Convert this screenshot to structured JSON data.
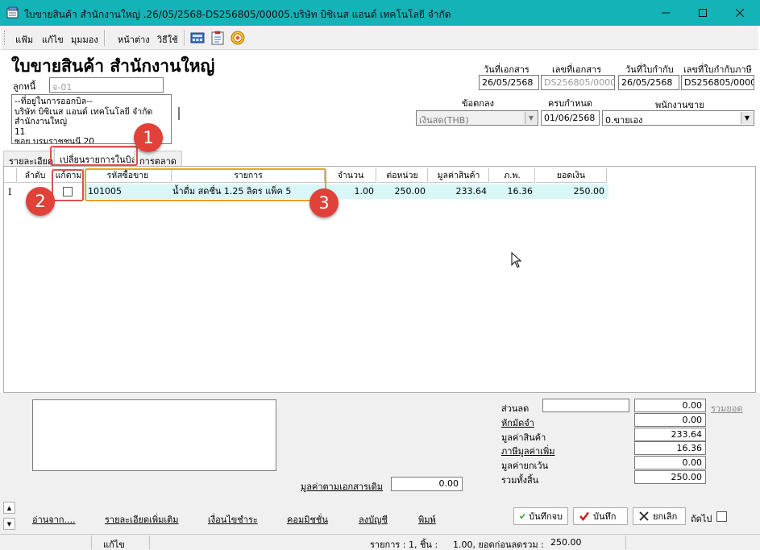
{
  "window": {
    "title": "ใบขายสินค้า สำนักงานใหญ่ .26/05/2568-DS256805/00005.บริษัท บิซิเนส แอนด์ เทคโนโลยี  จำกัด"
  },
  "menu": {
    "file": "แฟ้ม",
    "edit": "แก้ไข",
    "view": "มุมมอง",
    "window": "หน้าต่าง",
    "help": "วิธีใช้"
  },
  "form": {
    "title": "ใบขายสินค้า สำนักงานใหญ่",
    "debtor_label": "ลูกหนี้",
    "debtor_value": "จ-01",
    "address_lines": [
      "--ที่อยู่ในการออกบิล--",
      "บริษัท บิซิเนส แอนด์ เทคโนโลยี  จำกัด",
      "สำนักงานใหญ่",
      "11",
      "ซอย บรมราชชนนี 20"
    ],
    "doc_date_label": "วันที่เอกสาร",
    "doc_date": "26/05/2568",
    "doc_no_label": "เลขที่เอกสาร",
    "doc_no": "DS256805/00005",
    "tax_date_label": "วันที่ใบกำกับ",
    "tax_date": "26/05/2568",
    "tax_no_label": "เลขที่ใบกำกับภาษี",
    "tax_no": "DS256805/00005",
    "terms_label": "ข้อตกลง",
    "terms_value": "เงินสด(THB)",
    "due_label": "ครบกำหนด",
    "due_value": "01/06/2568",
    "salesperson_label": "พนักงานขาย",
    "salesperson_value": "0.ขายเอง"
  },
  "tabs": {
    "detail": "รายละเอียด",
    "change_items": "เปลี่ยนรายการในบิล",
    "marketing": "การตลาด"
  },
  "grid": {
    "headers": {
      "seq": "ลำดับ",
      "edit": "แก้ตาม",
      "code": "รหัสซื้อขาย",
      "item": "รายการ",
      "qty": "จำนวน",
      "unit_price": "ต่อหน่วย",
      "goods_value": "มูลค่าสินค้า",
      "vat": "ภ.พ.",
      "total": "ยอดเงิน"
    },
    "rows": [
      {
        "code": "101005",
        "item": "น้ำดื่ม สดชื่น 1.25 ลิตร แพ็ค 5",
        "qty": "1.00",
        "unit_price": "250.00",
        "goods_value": "233.64",
        "vat": "16.36",
        "total": "250.00"
      }
    ]
  },
  "callouts": {
    "one": "1",
    "two": "2",
    "three": "3"
  },
  "summary": {
    "discount_label": "ส่วนลด",
    "discount_input": "",
    "discount_value": "0.00",
    "sum_link": "รวมยอด",
    "deposit_label": "หักมัดจำ",
    "deposit_value": "0.00",
    "goods_label": "มูลค่าสินค้า",
    "goods_value": "233.64",
    "vat_label": "ภาษีมูลค่าเพิ่ม",
    "vat_value": "16.36",
    "exempt_label": "มูลค่ายกเว้น",
    "exempt_value": "0.00",
    "total_label": "รวมทั้งสิ้น",
    "total_value": "250.00",
    "orig_label": "มูลค่าตามเอกสารเดิม",
    "orig_value": "0.00"
  },
  "links": {
    "read_from": "อ่านจาก....",
    "more_detail": "รายละเอียดเพิ่มเติม",
    "payment_terms": "เงื่อนไขชำระ",
    "commission": "คอมมิชชั่น",
    "post": "ลงบัญชี",
    "print": "พิมพ์"
  },
  "buttons": {
    "save_close": "บันทึกจบ",
    "save": "บันทึก",
    "cancel": "ยกเลิก",
    "next": "ถัดไป"
  },
  "status": {
    "mode": "แก้ไข",
    "items": "รายการ : 1, ชิ้น :",
    "pieces": "1.00, ยอดก่อนลดรวม :",
    "amount": "250.00"
  },
  "colors": {
    "titlebar": "#14b3b8",
    "row_highlight": "#d9f7f7",
    "callout_red": "#e0423a",
    "callout_orange": "#f0a020"
  }
}
